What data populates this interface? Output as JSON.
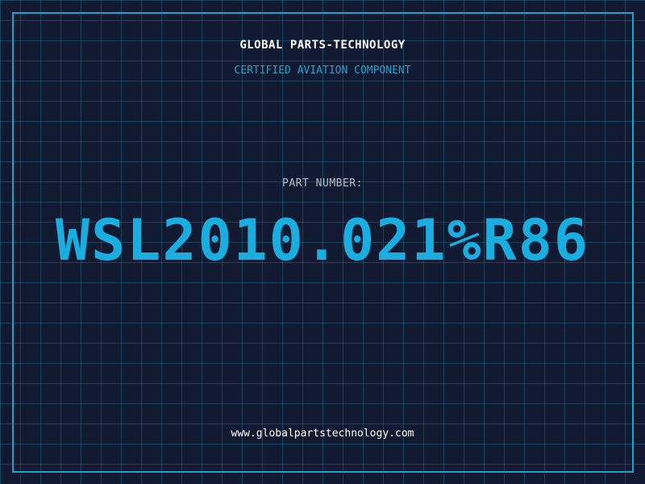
{
  "header": {
    "company": "GLOBAL PARTS-TECHNOLOGY",
    "subtitle": "CERTIFIED AVIATION COMPONENT"
  },
  "part": {
    "label": "PART NUMBER:",
    "number": "WSL2010.021%R86"
  },
  "footer": {
    "website": "www.globalpartstechnology.com"
  },
  "colors": {
    "background": "#111a30",
    "grid": "#2096b4",
    "accent": "#1aa5cf",
    "text": "#ffffff",
    "label": "#b4bcc8"
  }
}
